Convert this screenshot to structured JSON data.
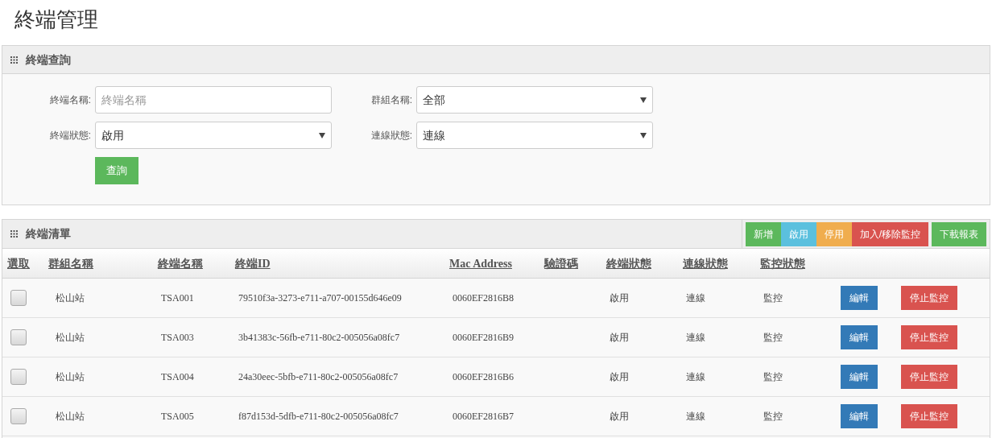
{
  "page_title": "終端管理",
  "query_panel": {
    "title": "終端查詢",
    "fields": [
      {
        "kind": "text",
        "label": "終端名稱:",
        "placeholder": "終端名稱"
      },
      {
        "kind": "select",
        "label": "群組名稱:",
        "value": "全部"
      },
      {
        "kind": "select",
        "label": "終端狀態:",
        "value": "啟用"
      },
      {
        "kind": "select",
        "label": "連線狀態:",
        "value": "連線"
      }
    ],
    "button": "查詢"
  },
  "list_panel": {
    "title": "終端清單",
    "actions": [
      {
        "label": "新增",
        "kind": "success"
      },
      {
        "label": "啟用",
        "kind": "info"
      },
      {
        "label": "停用",
        "kind": "warning"
      },
      {
        "label": "加入/移除監控",
        "kind": "danger"
      },
      {
        "label": "下載報表",
        "kind": "success"
      }
    ],
    "table": {
      "columns": [
        "選取",
        "群組名稱",
        "終端名稱",
        "終端ID",
        "Mac Address",
        "驗證碼",
        "終端狀態",
        "連線狀態",
        "監控狀態"
      ],
      "rows": [
        {
          "checked": false,
          "group": "松山站",
          "name": "TSA001",
          "id": "79510f3a-3273-e711-a707-00155d646e09",
          "mac": "0060EF2816B8",
          "status": "啟用",
          "connection": "連線",
          "monitor": "監控",
          "edit": "編輯",
          "stop": "停止監控"
        },
        {
          "checked": false,
          "group": "松山站",
          "name": "TSA003",
          "id": "3b41383c-56fb-e711-80c2-005056a08fc7",
          "mac": "0060EF2816B9",
          "status": "啟用",
          "connection": "連線",
          "monitor": "監控",
          "edit": "編輯",
          "stop": "停止監控"
        },
        {
          "checked": false,
          "group": "松山站",
          "name": "TSA004",
          "id": "24a30eec-5bfb-e711-80c2-005056a08fc7",
          "mac": "0060EF2816B6",
          "status": "啟用",
          "connection": "連線",
          "monitor": "監控",
          "edit": "編輯",
          "stop": "停止監控"
        },
        {
          "checked": false,
          "group": "松山站",
          "name": "TSA005",
          "id": "f87d153d-5dfb-e711-80c2-005056a08fc7",
          "mac": "0060EF2816B7",
          "status": "啟用",
          "connection": "連線",
          "monitor": "監控",
          "edit": "編輯",
          "stop": "停止監控"
        }
      ]
    }
  }
}
